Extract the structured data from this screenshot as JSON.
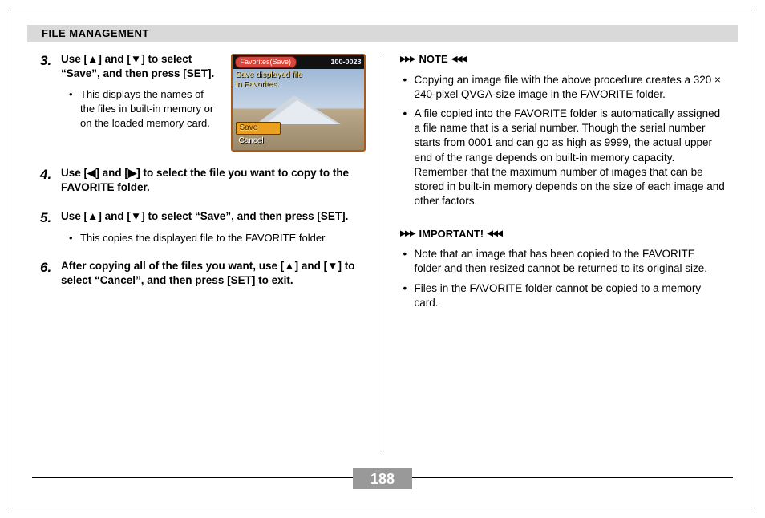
{
  "header": {
    "title": "FILE MANAGEMENT"
  },
  "steps": {
    "s3": {
      "num": "3.",
      "title_a": "Use [",
      "title_b": "] and [",
      "title_c": "] to select “Save”, and then press [SET].",
      "bullet": "This displays the names of the files in built-in memory or on the loaded memory card."
    },
    "s4": {
      "num": "4.",
      "title_a": "Use [",
      "title_b": "] and [",
      "title_c": "] to select the file you want to copy to the FAVORITE folder."
    },
    "s5": {
      "num": "5.",
      "title_a": "Use [",
      "title_b": "] and [",
      "title_c": "] to select “Save”, and then press [SET].",
      "bullet": "This copies the displayed file to the FAVORITE folder."
    },
    "s6": {
      "num": "6.",
      "title_a": "After copying all of the files you want, use [",
      "title_b": "] and [",
      "title_c": "] to select “Cancel”, and then press [SET] to exit."
    }
  },
  "lcd": {
    "tab": "Favorites(Save)",
    "counter": "100-0023",
    "msg1": "Save displayed file",
    "msg2": "in Favorites.",
    "opt_save": "Save",
    "opt_cancel": "Cancel"
  },
  "note": {
    "label": "NOTE",
    "b1": "Copying an image file with the above procedure creates a 320 × 240-pixel QVGA-size image in the FAVORITE folder.",
    "b2": "A file copied into the FAVORITE folder is automatically assigned a file name that is a serial number. Though the serial number starts from 0001 and can go as high as 9999, the actual upper end of the range depends on built-in memory capacity. Remember that the maximum number of images that can be stored in built-in memory depends on the size of each image and other factors."
  },
  "important": {
    "label": "IMPORTANT!",
    "b1": "Note that an image that has been copied to the FAVORITE folder and then resized cannot be returned to its original size.",
    "b2": "Files in the FAVORITE folder cannot be copied to a memory card."
  },
  "page": "188"
}
